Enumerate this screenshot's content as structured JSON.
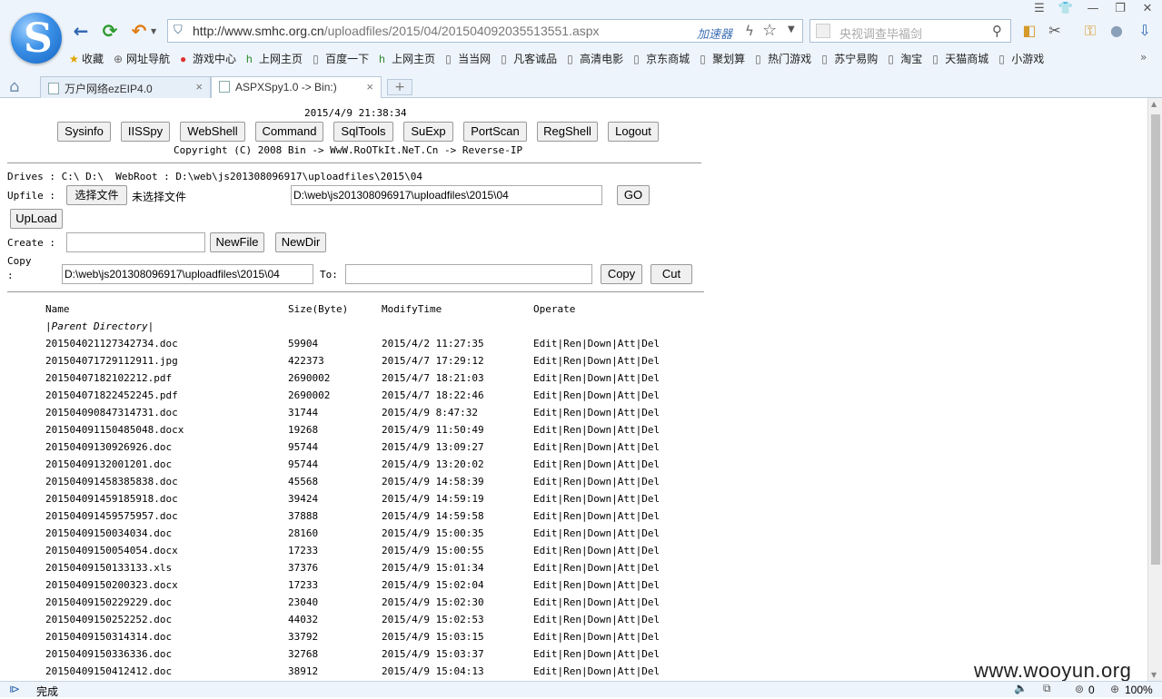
{
  "browser": {
    "url_prefix": "http://www.smhc.org.cn",
    "url_path": "/uploadfiles/2015/04/201504092035513551.aspx",
    "accelerator_label": "加速器",
    "search_placeholder": "央视调查毕福剑",
    "favorites": [
      {
        "label": "收藏",
        "icon": "star-icon"
      },
      {
        "label": "网址导航",
        "icon": "globe-icon"
      },
      {
        "label": "游戏中心",
        "icon": "game-icon"
      },
      {
        "label": "上网主页",
        "icon": "hao-icon"
      },
      {
        "label": "百度一下",
        "icon": "page-icon"
      },
      {
        "label": "上网主页",
        "icon": "hao-icon"
      },
      {
        "label": "当当网",
        "icon": "page-icon"
      },
      {
        "label": "凡客诚品",
        "icon": "page-icon"
      },
      {
        "label": "高清电影",
        "icon": "page-icon"
      },
      {
        "label": "京东商城",
        "icon": "page-icon"
      },
      {
        "label": "聚划算",
        "icon": "page-icon"
      },
      {
        "label": "热门游戏",
        "icon": "page-icon"
      },
      {
        "label": "苏宁易购",
        "icon": "page-icon"
      },
      {
        "label": "淘宝",
        "icon": "page-icon"
      },
      {
        "label": "天猫商城",
        "icon": "page-icon"
      },
      {
        "label": "小游戏",
        "icon": "page-icon"
      }
    ],
    "tabs": [
      {
        "label": "万户网络ezEIP4.0"
      },
      {
        "label": "ASPXSpy1.0 -> Bin:)"
      }
    ],
    "status_text": "完成",
    "status_count": "0",
    "zoom": "100%",
    "watermark": "www.wooyun.org"
  },
  "spy": {
    "datetime": "2015/4/9 21:38:34",
    "nav_buttons": [
      "Sysinfo",
      "IISSpy",
      "WebShell",
      "Command",
      "SqlTools",
      "SuExp",
      "PortScan",
      "RegShell",
      "Logout"
    ],
    "copyright": "Copyright (C) 2008 Bin -> WwW.RoOTkIt.NeT.Cn -> Reverse-IP",
    "drives_line": "Drives : C:\\ D:\\  WebRoot : D:\\web\\js201308096917\\uploadfiles\\2015\\04",
    "upfile_label": "Upfile :",
    "choose_file": "选择文件",
    "no_file": "未选择文件",
    "path_value": "D:\\web\\js201308096917\\uploadfiles\\2015\\04",
    "go_label": "GO",
    "upload_label": "UpLoad",
    "create_label": "Create :",
    "newfile_label": "NewFile",
    "newdir_label": "NewDir",
    "copy_label_1": "Copy",
    "copy_label_2": ":",
    "copy_src": "D:\\web\\js201308096917\\uploadfiles\\2015\\04",
    "to_label": "To:",
    "copy_btn": "Copy",
    "cut_btn": "Cut",
    "columns": {
      "name": "Name",
      "size": "Size(Byte)",
      "time": "ModifyTime",
      "op": "Operate"
    },
    "parent_dir": "|Parent Directory|",
    "files": [
      {
        "name": "201504021127342734.doc",
        "size": "59904",
        "time": "2015/4/2 11:27:35"
      },
      {
        "name": "201504071729112911.jpg",
        "size": "422373",
        "time": "2015/4/7 17:29:12"
      },
      {
        "name": "20150407182102212.pdf",
        "size": "2690002",
        "time": "2015/4/7 18:21:03"
      },
      {
        "name": "201504071822452245.pdf",
        "size": "2690002",
        "time": "2015/4/7 18:22:46"
      },
      {
        "name": "201504090847314731.doc",
        "size": "31744",
        "time": "2015/4/9 8:47:32"
      },
      {
        "name": "201504091150485048.docx",
        "size": "19268",
        "time": "2015/4/9 11:50:49"
      },
      {
        "name": "20150409130926926.doc",
        "size": "95744",
        "time": "2015/4/9 13:09:27"
      },
      {
        "name": "20150409132001201.doc",
        "size": "95744",
        "time": "2015/4/9 13:20:02"
      },
      {
        "name": "201504091458385838.doc",
        "size": "45568",
        "time": "2015/4/9 14:58:39"
      },
      {
        "name": "201504091459185918.doc",
        "size": "39424",
        "time": "2015/4/9 14:59:19"
      },
      {
        "name": "201504091459575957.doc",
        "size": "37888",
        "time": "2015/4/9 14:59:58"
      },
      {
        "name": "20150409150034034.doc",
        "size": "28160",
        "time": "2015/4/9 15:00:35"
      },
      {
        "name": "20150409150054054.docx",
        "size": "17233",
        "time": "2015/4/9 15:00:55"
      },
      {
        "name": "20150409150133133.xls",
        "size": "37376",
        "time": "2015/4/9 15:01:34"
      },
      {
        "name": "20150409150200323.docx",
        "size": "17233",
        "time": "2015/4/9 15:02:04"
      },
      {
        "name": "20150409150229229.doc",
        "size": "23040",
        "time": "2015/4/9 15:02:30"
      },
      {
        "name": "20150409150252252.doc",
        "size": "44032",
        "time": "2015/4/9 15:02:53"
      },
      {
        "name": "20150409150314314.doc",
        "size": "33792",
        "time": "2015/4/9 15:03:15"
      },
      {
        "name": "20150409150336336.doc",
        "size": "32768",
        "time": "2015/4/9 15:03:37"
      },
      {
        "name": "20150409150412412.doc",
        "size": "38912",
        "time": "2015/4/9 15:04:13"
      }
    ],
    "operate": "Edit|Ren|Down|Att|Del"
  }
}
